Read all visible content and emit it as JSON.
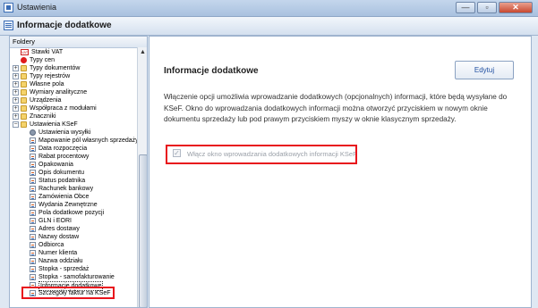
{
  "window": {
    "title": "Ustawienia",
    "buttons": [
      "—",
      "▫",
      "✕"
    ]
  },
  "header": {
    "title": "Informacje dodatkowe"
  },
  "sidebar": {
    "label": "Foldery",
    "items": [
      {
        "label": "Stawki VAT",
        "icon": "vat-icon",
        "indent": 1
      },
      {
        "label": "Typy cen",
        "icon": "red-dot-icon",
        "indent": 1
      },
      {
        "label": "Typy dokumentów",
        "icon": "folder-icon",
        "indent": 1,
        "expand": "+"
      },
      {
        "label": "Typy rejestrów",
        "icon": "folder-icon",
        "indent": 1,
        "expand": "+"
      },
      {
        "label": "Własne pola",
        "icon": "folder-icon",
        "indent": 1,
        "expand": "+"
      },
      {
        "label": "Wymiary analityczne",
        "icon": "folder-icon",
        "indent": 1,
        "expand": "+"
      },
      {
        "label": "Urządzenia",
        "icon": "folder-icon",
        "indent": 1,
        "expand": "+"
      },
      {
        "label": "Współpraca z modułami",
        "icon": "folder-icon",
        "indent": 1,
        "expand": "+"
      },
      {
        "label": "Znaczniki",
        "icon": "folder-icon",
        "indent": 1,
        "expand": "+"
      },
      {
        "label": "Ustawienia KSeF",
        "icon": "folder-icon",
        "indent": 1,
        "expand": "−"
      },
      {
        "label": "Ustawienia wysyłki",
        "icon": "gear-icon",
        "indent": 2
      },
      {
        "label": "Mapowanie pól własnych sprzedaży",
        "icon": "doc-icon",
        "indent": 2
      },
      {
        "label": "Data rozpoczęcia",
        "icon": "doc-icon",
        "indent": 2
      },
      {
        "label": "Rabat procentowy",
        "icon": "doc-icon",
        "indent": 2
      },
      {
        "label": "Opakowania",
        "icon": "doc-icon",
        "indent": 2
      },
      {
        "label": "Opis dokumentu",
        "icon": "doc-icon",
        "indent": 2
      },
      {
        "label": "Status podatnika",
        "icon": "doc-icon",
        "indent": 2
      },
      {
        "label": "Rachunek bankowy",
        "icon": "doc-icon",
        "indent": 2
      },
      {
        "label": "Zamówienia Obce",
        "icon": "doc-icon",
        "indent": 2
      },
      {
        "label": "Wydania Zewnętrzne",
        "icon": "doc-icon",
        "indent": 2
      },
      {
        "label": "Pola dodatkowe pozycji",
        "icon": "doc-icon",
        "indent": 2
      },
      {
        "label": "GLN i EORI",
        "icon": "doc-icon",
        "indent": 2
      },
      {
        "label": "Adres dostawy",
        "icon": "doc-icon",
        "indent": 2
      },
      {
        "label": "Nazwy dostaw",
        "icon": "doc-icon",
        "indent": 2
      },
      {
        "label": "Odbiorca",
        "icon": "doc-icon",
        "indent": 2
      },
      {
        "label": "Numer klienta",
        "icon": "doc-icon",
        "indent": 2
      },
      {
        "label": "Nazwa oddziału",
        "icon": "doc-icon",
        "indent": 2
      },
      {
        "label": "Stopka - sprzedaż",
        "icon": "doc-icon",
        "indent": 2
      },
      {
        "label": "Stopka - samofakturowanie",
        "icon": "doc-icon",
        "indent": 2
      },
      {
        "label": "Informacje dodatkowe",
        "icon": "doc-icon",
        "indent": 2,
        "selected": true
      },
      {
        "label": "Szczegóły faktur na KSeF",
        "icon": "doc-icon",
        "indent": 2
      }
    ]
  },
  "main": {
    "title": "Informacje dodatkowe",
    "edit_label": "Edytuj",
    "description": "Włączenie opcji umożliwia wprowadzanie dodatkowych (opcjonalnych) informacji, które będą wysyłane do KSeF. Okno do wprowadzania dodatkowych informacji można otworzyć przyciskiem w nowym oknie dokumentu sprzedaży lub pod prawym przyciskiem myszy w oknie klasycznym sprzedaży.",
    "checkbox_label": "Włącz okno wprowadzania dodatkowych informacji KSeF",
    "checkbox_checked": true,
    "checkbox_enabled": false
  },
  "colors": {
    "highlight": "#e8141c",
    "accent": "#1f4fa0"
  }
}
